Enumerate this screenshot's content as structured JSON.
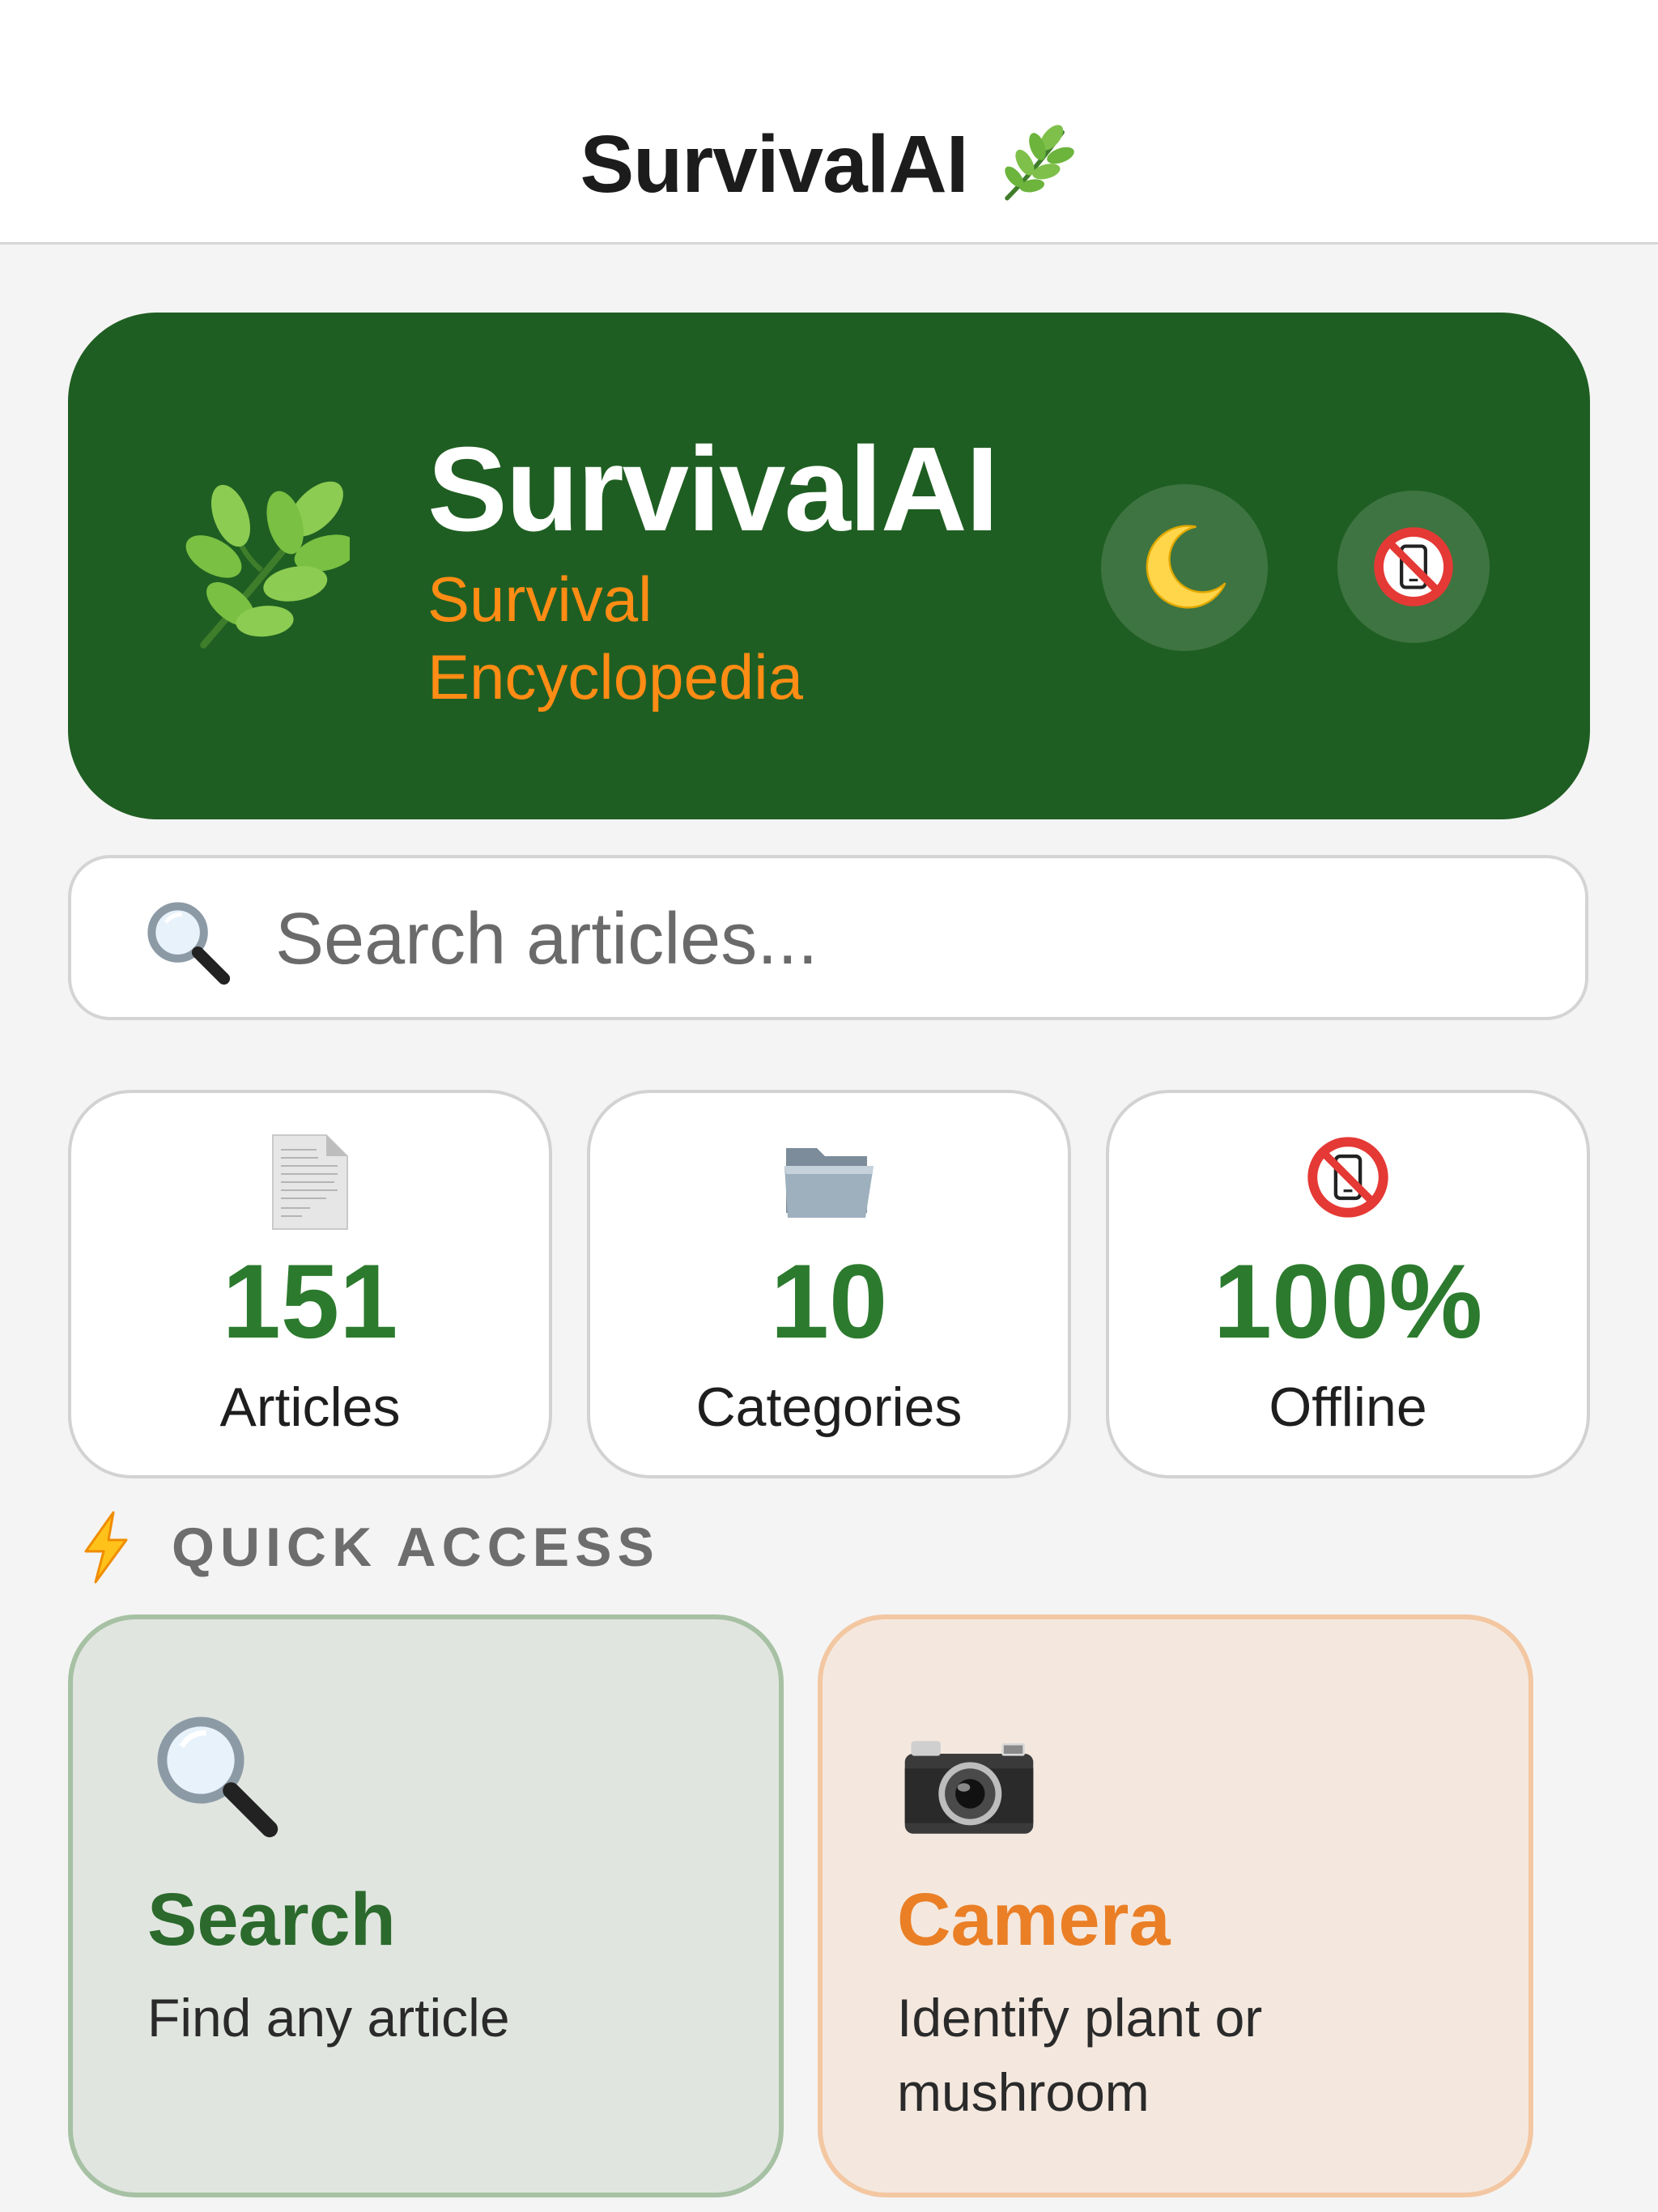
{
  "nav": {
    "title": "SurvivalAI",
    "icon": "herb-icon"
  },
  "hero": {
    "title": "SurvivalAI",
    "subtitle": "Survival Encyclopedia",
    "icon": "herb-icon",
    "moon_button_icon": "crescent-moon-icon",
    "offline_button_icon": "no-mobile-phones-icon"
  },
  "search": {
    "placeholder": "Search articles...",
    "value": "",
    "icon": "magnifying-glass-icon"
  },
  "stats": [
    {
      "value": "151",
      "label": "Articles",
      "icon": "document-icon"
    },
    {
      "value": "10",
      "label": "Categories",
      "icon": "folder-icon"
    },
    {
      "value": "100%",
      "label": "Offline",
      "icon": "no-mobile-phones-icon"
    }
  ],
  "quick_access": {
    "title": "QUICK ACCESS",
    "icon": "lightning-icon",
    "cards": [
      {
        "title": "Search",
        "description": "Find any article",
        "icon": "magnifying-glass-icon"
      },
      {
        "title": "Camera",
        "description": "Identify plant or mushroom",
        "icon": "camera-icon"
      }
    ]
  },
  "colors": {
    "brand_green": "#1f5e22",
    "stat_green": "#2c7a2e",
    "accent_orange": "#ff8c14",
    "camera_orange": "#ea7f26"
  }
}
